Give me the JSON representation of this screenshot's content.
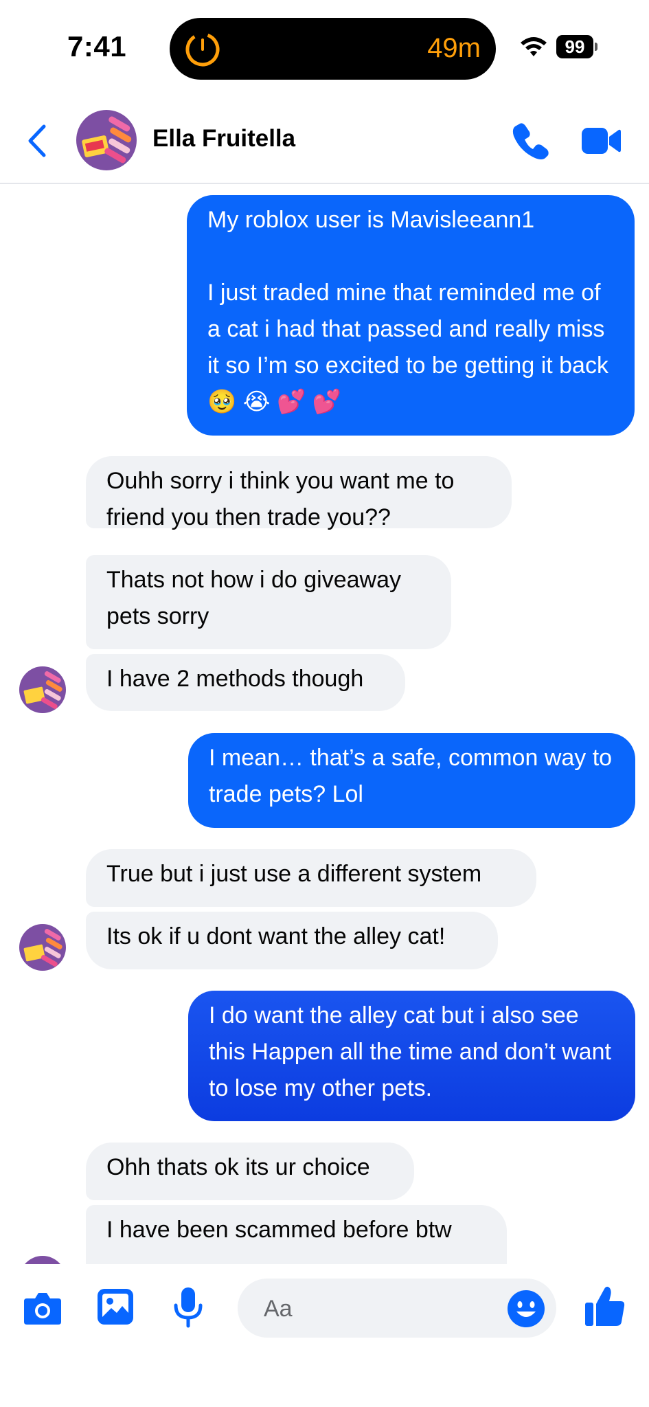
{
  "status": {
    "time": "7:41",
    "island_timer": "49m",
    "battery": "99",
    "colors": {
      "timer": "#ff9f0a"
    }
  },
  "header": {
    "contact_name": "Ella Fruitella",
    "icons": [
      "back-icon",
      "contact-avatar",
      "call-icon",
      "video-call-icon"
    ],
    "accent": "#0866ff"
  },
  "messages": [
    {
      "from": "me",
      "text": "My roblox user is Mavisleeann1\n\nI just traded mine that reminded me of a cat i had that passed and really miss it so I’m so excited to be getting it back 🥹 😭 💕 💕"
    },
    {
      "from": "them",
      "text": "Ouhh sorry i think you want me to friend you then trade you??"
    },
    {
      "from": "them",
      "text": "Thats not how i do giveaway pets sorry"
    },
    {
      "from": "them",
      "text": "I have 2 methods though"
    },
    {
      "from": "me",
      "text": "I mean… that’s a safe, common way to trade pets? Lol"
    },
    {
      "from": "them",
      "text": "True but i just use a different system"
    },
    {
      "from": "them",
      "text": "Its ok if u dont want the alley cat!"
    },
    {
      "from": "me",
      "text": "I do want the alley cat but i also see this Happen all the time and don’t want to lose my other pets."
    },
    {
      "from": "them",
      "text": "Ohh thats ok its ur choice"
    },
    {
      "from": "them",
      "text": "I have been scammed before btw"
    }
  ],
  "composer": {
    "placeholder": "Aa",
    "icons": [
      "camera-icon",
      "gallery-icon",
      "microphone-icon",
      "emoji-icon",
      "thumbs-up-icon"
    ]
  }
}
